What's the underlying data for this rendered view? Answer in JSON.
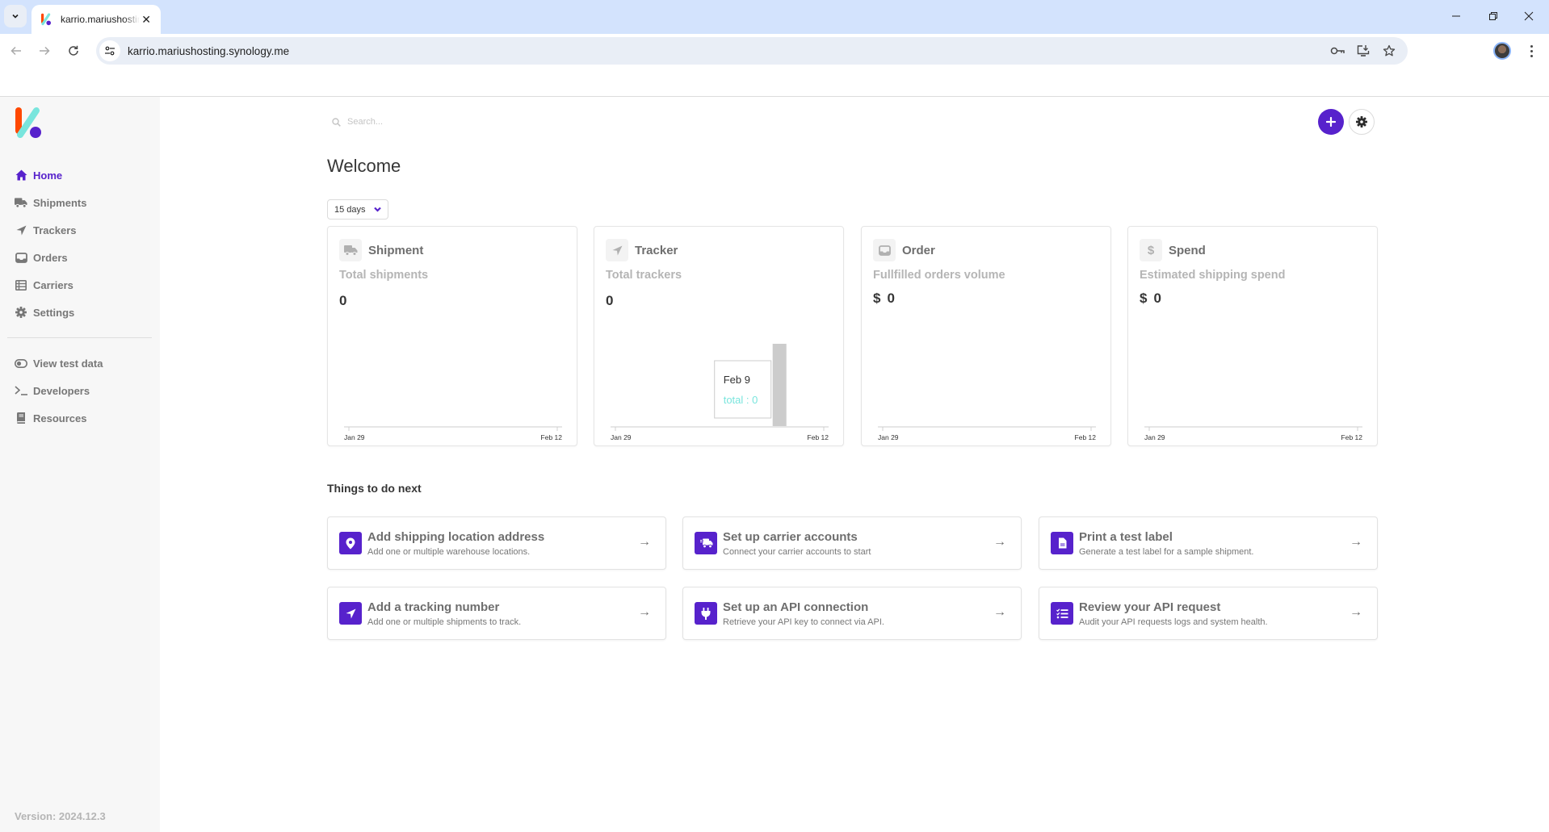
{
  "browser": {
    "tab_title": "karrio.mariushosting.synology.me",
    "url": "karrio.mariushosting.synology.me",
    "window_controls": [
      "minimize",
      "restore",
      "close"
    ]
  },
  "sidebar": {
    "items": [
      {
        "label": "Home",
        "icon": "home-icon",
        "active": true
      },
      {
        "label": "Shipments",
        "icon": "truck-icon",
        "active": false
      },
      {
        "label": "Trackers",
        "icon": "location-arrow-icon",
        "active": false
      },
      {
        "label": "Orders",
        "icon": "inbox-icon",
        "active": false
      },
      {
        "label": "Carriers",
        "icon": "list-table-icon",
        "active": false
      },
      {
        "label": "Settings",
        "icon": "gear-icon",
        "active": false
      }
    ],
    "secondary_items": [
      {
        "label": "View test data",
        "icon": "toggle-icon"
      },
      {
        "label": "Developers",
        "icon": "terminal-icon"
      },
      {
        "label": "Resources",
        "icon": "book-icon"
      }
    ],
    "version": "Version: 2024.12.3"
  },
  "header": {
    "search_placeholder": "Search...",
    "add_label": "+",
    "page_title": "Welcome",
    "period": "15 days"
  },
  "colors": {
    "brand": "#5722cc",
    "logo_orange": "#ff4800",
    "logo_teal": "#79e5dd",
    "tooltip_value": "#79e5dd"
  },
  "stats": [
    {
      "title": "Shipment",
      "icon": "truck-icon",
      "label": "Total shipments",
      "currency": "",
      "value": "0"
    },
    {
      "title": "Tracker",
      "icon": "location-arrow-icon",
      "label": "Total trackers",
      "currency": "",
      "value": "0"
    },
    {
      "title": "Order",
      "icon": "inbox-icon",
      "label": "Fullfilled orders volume",
      "currency": "$",
      "value": "0"
    },
    {
      "title": "Spend",
      "icon": "dollar-icon",
      "label": "Estimated shipping spend",
      "currency": "$",
      "value": "0"
    }
  ],
  "chart_data": [
    {
      "type": "bar",
      "title": "Shipment",
      "x_ticks": [
        "Jan 29",
        "Feb 12"
      ],
      "x_range": [
        "Jan 29",
        "Feb 12"
      ],
      "values": "all 0",
      "ylim": [
        0,
        1
      ],
      "grid": false
    },
    {
      "type": "bar",
      "title": "Tracker",
      "x_ticks": [
        "Jan 29",
        "Feb 12"
      ],
      "x_range": [
        "Jan 29",
        "Feb 12"
      ],
      "values": "all 0",
      "ylim": [
        0,
        1
      ],
      "grid": false,
      "tooltip": {
        "date": "Feb 9",
        "series": "total",
        "value": 0,
        "text": "total : 0"
      },
      "hover_index_date": "Feb 9"
    },
    {
      "type": "bar",
      "title": "Order",
      "x_ticks": [
        "Jan 29",
        "Feb 12"
      ],
      "x_range": [
        "Jan 29",
        "Feb 12"
      ],
      "values": "all 0",
      "ylim": [
        0,
        1
      ],
      "grid": false
    },
    {
      "type": "bar",
      "title": "Spend",
      "x_ticks": [
        "Jan 29",
        "Feb 12"
      ],
      "x_range": [
        "Jan 29",
        "Feb 12"
      ],
      "values": "all 0",
      "ylim": [
        0,
        1
      ],
      "grid": false
    }
  ],
  "next_steps": {
    "title": "Things to do next",
    "items": [
      {
        "title": "Add shipping location address",
        "desc": "Add one or multiple warehouse locations.",
        "icon": "map-pin-icon"
      },
      {
        "title": "Set up carrier accounts",
        "desc": "Connect your carrier accounts to start",
        "icon": "shipping-fast-icon"
      },
      {
        "title": "Print a test label",
        "desc": "Generate a test label for a sample shipment.",
        "icon": "file-label-icon"
      },
      {
        "title": "Add a tracking number",
        "desc": "Add one or multiple shipments to track.",
        "icon": "location-arrow-icon"
      },
      {
        "title": "Set up an API connection",
        "desc": "Retrieve your API key to connect via API.",
        "icon": "plug-icon"
      },
      {
        "title": "Review your API request",
        "desc": "Audit your API requests logs and system health.",
        "icon": "tasks-list-icon"
      }
    ]
  }
}
